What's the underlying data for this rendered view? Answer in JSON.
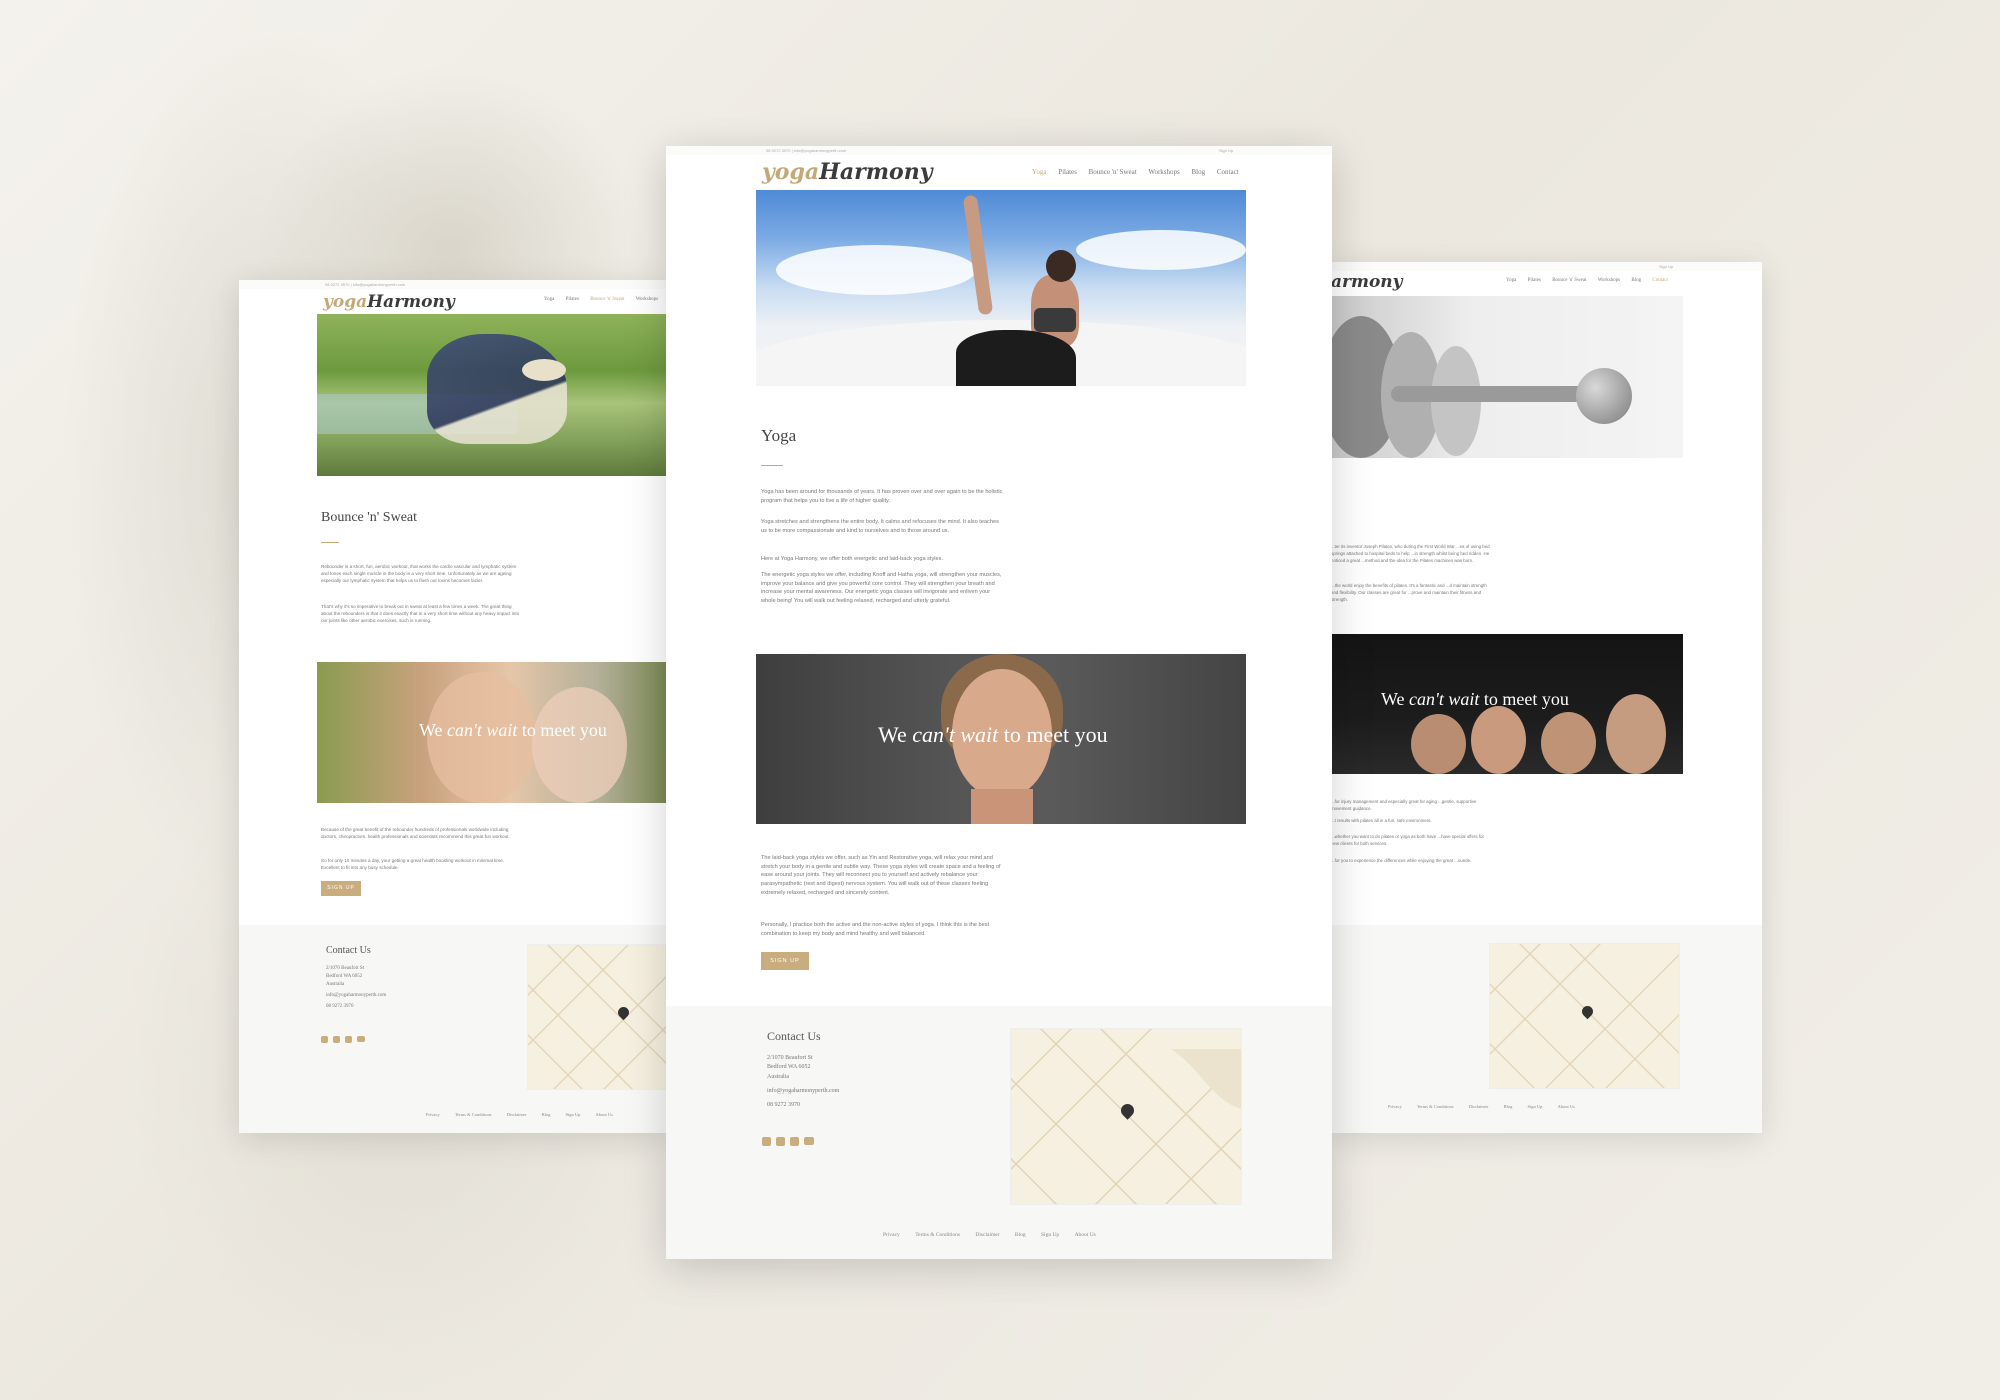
{
  "site": {
    "logo_yoga": "yoga",
    "logo_harmony": "Harmony",
    "logo_harmony_cropped": "armony",
    "topbar_contact": "08 9272 3970 | info@yogaharmonyperth.com",
    "topbar_signup": "Sign Up"
  },
  "nav_left": [
    "Yoga",
    "Pilates",
    "Bounce 'n' Sweat",
    "Workshops"
  ],
  "nav_center": [
    "Yoga",
    "Pilates",
    "Bounce 'n' Sweat",
    "Workshops",
    "Blog",
    "Contact"
  ],
  "nav_right": [
    "Yoga",
    "Pilates",
    "Bounce 'n' Sweat",
    "Workshops",
    "Blog",
    "Contact"
  ],
  "left_page": {
    "title": "Bounce 'n' Sweat",
    "para1": "Rebounder is a short, fun, aerobic workout, that works the cardio vascular and lymphatic system and tones each single muscle in the body in a very short time. Unfortunately as we are ageing especially our lymphatic system that helps us to flush out toxins becomes lazier.",
    "para2": "That's why it's so imperative to break out in sweat at least a few times a week. The great thing about the rebounders is that it does exactly that in a very short time without any heavy impact into our joints like other aerobic exercises, such is running.",
    "para3": "Because of the great benefit of the rebounder hundreds of professionals worldwide including doctors, chiropractors, health professionals and scientists recommend this great fun workout.",
    "para4": "So for only 10 minutes a day, your getting a great health boosting workout in minimal time. Excellent to fit into any busy schedule.",
    "button": "SIGN UP",
    "slogan_pre": "We ",
    "slogan_em": "can't wait",
    "slogan_post": " to meet you"
  },
  "center_page": {
    "title": "Yoga",
    "para1": "Yoga has been around for thousands of years. It has proven over and over again to be the holistic program that helps you to live a life of higher quality.",
    "para2": "Yoga stretches and strengthens the entire body. It calms and refocuses the mind. It also teaches us to be more compassionate and kind to ourselves and to those around us.",
    "para3": "Here at Yoga Harmony, we offer both energetic and laid-back yoga styles.",
    "para4": "The energetic yoga styles we offer, including Knoff and Hatha yoga, will strengthen your muscles, improve your balance and give you powerful core control. They will strengthen your breath and increase your mental awareness. Our energetic yoga classes will invigorate and enliven your whole being! You will walk out feeling relaxed, recharged and utterly grateful.",
    "slogan_pre": "We ",
    "slogan_em": "can't wait",
    "slogan_post": " to meet you",
    "para5": "The laid-back yoga styles we offer, such as Yin and Restorative yoga, will relax your mind and stretch your body in a gentle and subtle way. These yoga styles will create space and a feeling of ease around your joints. They will reconnect you to yourself and actively rebalance your parasympathetic (rest and digest) nervous system. You will walk out of these classes feeling extremely relaxed, recharged and sincerely content.",
    "para6": "Personally, I practice both the active and the non-active styles of yoga. I think this is the best combination to keep my body and mind healthy and well balanced.",
    "button": "SIGN UP"
  },
  "right_page": {
    "para1": "...ter its inventor Joseph Pilates, who during the First World War ...ea of using bed springs attached to hospital beds to help ...in strength whilst being bed ridden. He noticed a great ...method and the idea for the Pilates machines was born.",
    "para2": "...the world enjoy the benefits of pilates. It's a fantastic and ...d maintain strength and flexibility. Our classes are great for ...prove and maintain their fitness and strength.",
    "slogan_pre": "We ",
    "slogan_em": "can't wait",
    "slogan_post": " to meet you",
    "para3": "...for injury management and especially great for aging ...gentle, supportive movement guidance.",
    "para4": "...t results with pilates all in a fun, safe environment.",
    "para5": "...whether you want to do pilates or yoga as both have ...have special offers for new clients for both services.",
    "para6": "...for you to experience the differences while enjoying the great ...ounde."
  },
  "footer": {
    "contact_title": "Contact Us",
    "address1": "2/1070 Beaufort St",
    "address2": "Bedford WA 6052",
    "address3": "Australia",
    "email": "info@yogaharmonyperth.com",
    "phone": "08 9272 3970",
    "links": [
      "Privacy",
      "Terms & Conditions",
      "Disclaimer",
      "Blog",
      "Sign Up",
      "About Us"
    ]
  },
  "colors": {
    "accent": "#c4a878",
    "button": "#c9ad7f",
    "footer_bg": "#f7f7f6"
  },
  "icons": [
    "facebook-icon",
    "twitter-icon",
    "instagram-icon",
    "youtube-icon",
    "map-pin-icon"
  ]
}
